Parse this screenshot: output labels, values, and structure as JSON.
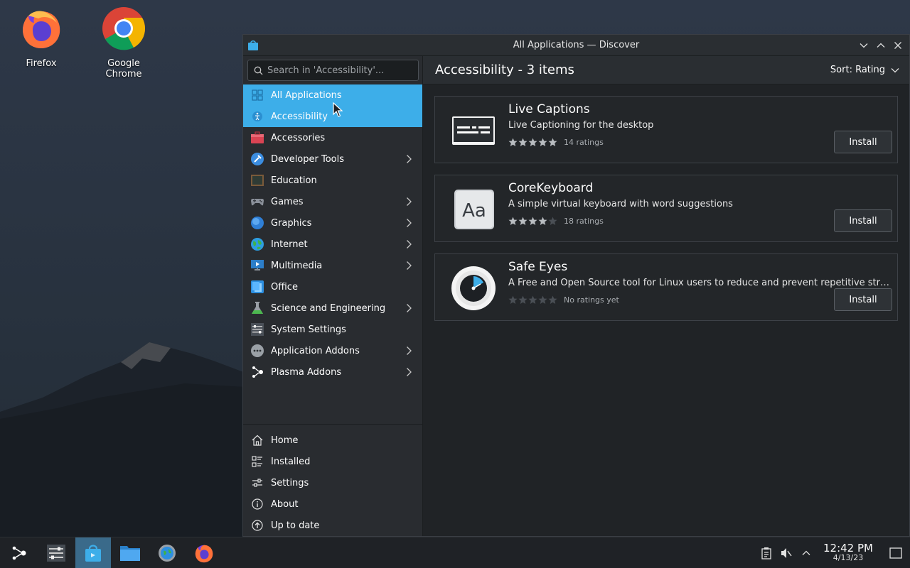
{
  "desktop": {
    "icons": [
      {
        "label": "Firefox"
      },
      {
        "label": "Google Chrome"
      }
    ]
  },
  "window": {
    "title": "All Applications — Discover"
  },
  "search": {
    "placeholder": "Search in 'Accessibility'..."
  },
  "sidebar": {
    "categories": [
      {
        "label": "All Applications",
        "icon": "grid-icon",
        "submenu": false
      },
      {
        "label": "Accessibility",
        "icon": "accessibility-icon",
        "submenu": false
      },
      {
        "label": "Accessories",
        "icon": "toolbox-icon",
        "submenu": false
      },
      {
        "label": "Developer Tools",
        "icon": "hammer-icon",
        "submenu": true
      },
      {
        "label": "Education",
        "icon": "chalkboard-icon",
        "submenu": false
      },
      {
        "label": "Games",
        "icon": "gamepad-icon",
        "submenu": true
      },
      {
        "label": "Graphics",
        "icon": "graphics-icon",
        "submenu": true
      },
      {
        "label": "Internet",
        "icon": "globe-icon",
        "submenu": true
      },
      {
        "label": "Multimedia",
        "icon": "multimedia-icon",
        "submenu": true
      },
      {
        "label": "Office",
        "icon": "office-icon",
        "submenu": false
      },
      {
        "label": "Science and Engineering",
        "icon": "flask-icon",
        "submenu": true
      },
      {
        "label": "System Settings",
        "icon": "settings-panel-icon",
        "submenu": false
      },
      {
        "label": "Application Addons",
        "icon": "addons-icon",
        "submenu": true
      },
      {
        "label": "Plasma Addons",
        "icon": "plasma-icon",
        "submenu": true
      }
    ],
    "bottom": [
      {
        "label": "Home",
        "icon": "home-icon"
      },
      {
        "label": "Installed",
        "icon": "installed-icon"
      },
      {
        "label": "Settings",
        "icon": "sliders-icon"
      },
      {
        "label": "About",
        "icon": "info-icon"
      },
      {
        "label": "Up to date",
        "icon": "upload-icon"
      }
    ]
  },
  "header": {
    "title": "Accessibility - 3 items",
    "sort_label": "Sort: Rating"
  },
  "apps": [
    {
      "name": "Live Captions",
      "description": "Live Captioning for the desktop",
      "stars": 5,
      "ratings": "14 ratings",
      "action": "Install"
    },
    {
      "name": "CoreKeyboard",
      "description": "A simple virtual keyboard with word suggestions",
      "stars": 4,
      "ratings": "18 ratings",
      "action": "Install",
      "icon_text": "Aa"
    },
    {
      "name": "Safe Eyes",
      "description": "A Free and Open Source tool for Linux users to reduce and prevent repetitive strain inj...",
      "stars": 0,
      "ratings": "No ratings yet",
      "action": "Install"
    }
  ],
  "taskbar": {
    "time": "12:42 PM",
    "date": "4/13/23"
  },
  "colors": {
    "accent": "#3daee9",
    "window_bg": "#202326",
    "sidebar_bg": "#292c30"
  }
}
